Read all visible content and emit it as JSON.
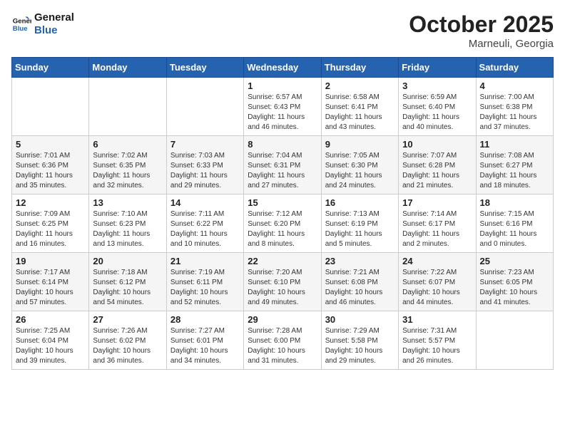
{
  "logo": {
    "line1": "General",
    "line2": "Blue"
  },
  "title": "October 2025",
  "subtitle": "Marneuli, Georgia",
  "weekdays": [
    "Sunday",
    "Monday",
    "Tuesday",
    "Wednesday",
    "Thursday",
    "Friday",
    "Saturday"
  ],
  "weeks": [
    [
      {
        "day": "",
        "info": ""
      },
      {
        "day": "",
        "info": ""
      },
      {
        "day": "",
        "info": ""
      },
      {
        "day": "1",
        "info": "Sunrise: 6:57 AM\nSunset: 6:43 PM\nDaylight: 11 hours\nand 46 minutes."
      },
      {
        "day": "2",
        "info": "Sunrise: 6:58 AM\nSunset: 6:41 PM\nDaylight: 11 hours\nand 43 minutes."
      },
      {
        "day": "3",
        "info": "Sunrise: 6:59 AM\nSunset: 6:40 PM\nDaylight: 11 hours\nand 40 minutes."
      },
      {
        "day": "4",
        "info": "Sunrise: 7:00 AM\nSunset: 6:38 PM\nDaylight: 11 hours\nand 37 minutes."
      }
    ],
    [
      {
        "day": "5",
        "info": "Sunrise: 7:01 AM\nSunset: 6:36 PM\nDaylight: 11 hours\nand 35 minutes."
      },
      {
        "day": "6",
        "info": "Sunrise: 7:02 AM\nSunset: 6:35 PM\nDaylight: 11 hours\nand 32 minutes."
      },
      {
        "day": "7",
        "info": "Sunrise: 7:03 AM\nSunset: 6:33 PM\nDaylight: 11 hours\nand 29 minutes."
      },
      {
        "day": "8",
        "info": "Sunrise: 7:04 AM\nSunset: 6:31 PM\nDaylight: 11 hours\nand 27 minutes."
      },
      {
        "day": "9",
        "info": "Sunrise: 7:05 AM\nSunset: 6:30 PM\nDaylight: 11 hours\nand 24 minutes."
      },
      {
        "day": "10",
        "info": "Sunrise: 7:07 AM\nSunset: 6:28 PM\nDaylight: 11 hours\nand 21 minutes."
      },
      {
        "day": "11",
        "info": "Sunrise: 7:08 AM\nSunset: 6:27 PM\nDaylight: 11 hours\nand 18 minutes."
      }
    ],
    [
      {
        "day": "12",
        "info": "Sunrise: 7:09 AM\nSunset: 6:25 PM\nDaylight: 11 hours\nand 16 minutes."
      },
      {
        "day": "13",
        "info": "Sunrise: 7:10 AM\nSunset: 6:23 PM\nDaylight: 11 hours\nand 13 minutes."
      },
      {
        "day": "14",
        "info": "Sunrise: 7:11 AM\nSunset: 6:22 PM\nDaylight: 11 hours\nand 10 minutes."
      },
      {
        "day": "15",
        "info": "Sunrise: 7:12 AM\nSunset: 6:20 PM\nDaylight: 11 hours\nand 8 minutes."
      },
      {
        "day": "16",
        "info": "Sunrise: 7:13 AM\nSunset: 6:19 PM\nDaylight: 11 hours\nand 5 minutes."
      },
      {
        "day": "17",
        "info": "Sunrise: 7:14 AM\nSunset: 6:17 PM\nDaylight: 11 hours\nand 2 minutes."
      },
      {
        "day": "18",
        "info": "Sunrise: 7:15 AM\nSunset: 6:16 PM\nDaylight: 11 hours\nand 0 minutes."
      }
    ],
    [
      {
        "day": "19",
        "info": "Sunrise: 7:17 AM\nSunset: 6:14 PM\nDaylight: 10 hours\nand 57 minutes."
      },
      {
        "day": "20",
        "info": "Sunrise: 7:18 AM\nSunset: 6:12 PM\nDaylight: 10 hours\nand 54 minutes."
      },
      {
        "day": "21",
        "info": "Sunrise: 7:19 AM\nSunset: 6:11 PM\nDaylight: 10 hours\nand 52 minutes."
      },
      {
        "day": "22",
        "info": "Sunrise: 7:20 AM\nSunset: 6:10 PM\nDaylight: 10 hours\nand 49 minutes."
      },
      {
        "day": "23",
        "info": "Sunrise: 7:21 AM\nSunset: 6:08 PM\nDaylight: 10 hours\nand 46 minutes."
      },
      {
        "day": "24",
        "info": "Sunrise: 7:22 AM\nSunset: 6:07 PM\nDaylight: 10 hours\nand 44 minutes."
      },
      {
        "day": "25",
        "info": "Sunrise: 7:23 AM\nSunset: 6:05 PM\nDaylight: 10 hours\nand 41 minutes."
      }
    ],
    [
      {
        "day": "26",
        "info": "Sunrise: 7:25 AM\nSunset: 6:04 PM\nDaylight: 10 hours\nand 39 minutes."
      },
      {
        "day": "27",
        "info": "Sunrise: 7:26 AM\nSunset: 6:02 PM\nDaylight: 10 hours\nand 36 minutes."
      },
      {
        "day": "28",
        "info": "Sunrise: 7:27 AM\nSunset: 6:01 PM\nDaylight: 10 hours\nand 34 minutes."
      },
      {
        "day": "29",
        "info": "Sunrise: 7:28 AM\nSunset: 6:00 PM\nDaylight: 10 hours\nand 31 minutes."
      },
      {
        "day": "30",
        "info": "Sunrise: 7:29 AM\nSunset: 5:58 PM\nDaylight: 10 hours\nand 29 minutes."
      },
      {
        "day": "31",
        "info": "Sunrise: 7:31 AM\nSunset: 5:57 PM\nDaylight: 10 hours\nand 26 minutes."
      },
      {
        "day": "",
        "info": ""
      }
    ]
  ]
}
